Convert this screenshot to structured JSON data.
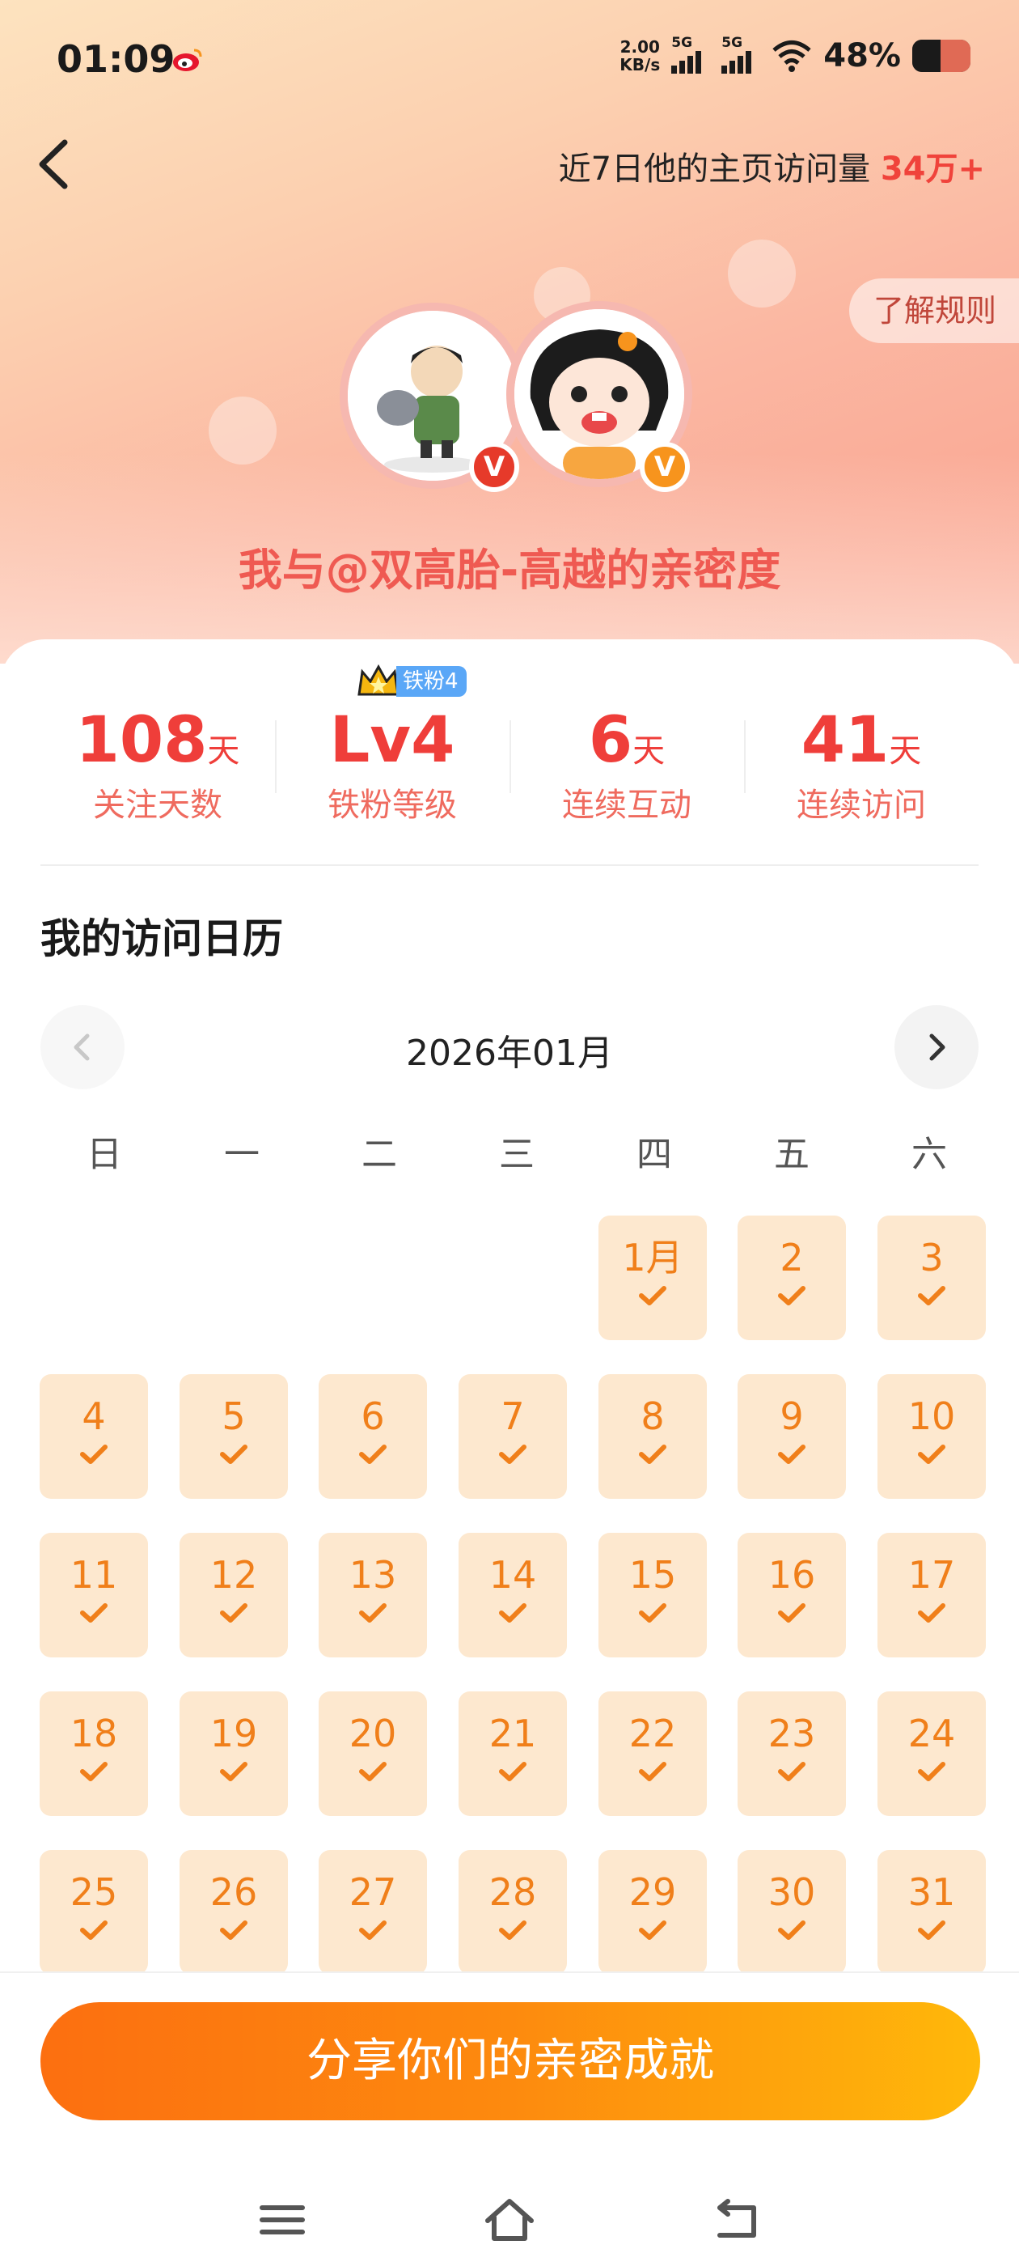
{
  "status_bar": {
    "time": "01:09",
    "net_speed_top": "2.00",
    "net_speed_bottom": "KB/s",
    "sim1": "5G",
    "sim2": "5G",
    "battery": "48%"
  },
  "header": {
    "visits_prefix": "近7日他的主页访问量",
    "visits_value": "34万+",
    "rules_label": "了解规则"
  },
  "intimacy_title": "我与@双高胎-高越的亲密度",
  "badges": {
    "v": "V"
  },
  "fan_badge": "铁粉4",
  "stats": [
    {
      "value": "108",
      "unit": "天",
      "label": "关注天数"
    },
    {
      "value": "Lv4",
      "unit": "",
      "label": "铁粉等级"
    },
    {
      "value": "6",
      "unit": "天",
      "label": "连续互动"
    },
    {
      "value": "41",
      "unit": "天",
      "label": "连续访问"
    }
  ],
  "calendar": {
    "title": "我的访问日历",
    "month": "2026年01月",
    "weekdays": [
      "日",
      "一",
      "二",
      "三",
      "四",
      "五",
      "六"
    ],
    "first_weekday_index": 4,
    "days": [
      "1月",
      "2",
      "3",
      "4",
      "5",
      "6",
      "7",
      "8",
      "9",
      "10",
      "11",
      "12",
      "13",
      "14",
      "15",
      "16",
      "17",
      "18",
      "19",
      "20",
      "21",
      "22",
      "23",
      "24",
      "25",
      "26",
      "27",
      "28",
      "29",
      "30",
      "31"
    ],
    "visited_all": true
  },
  "share_button": "分享你们的亲密成就",
  "colors": {
    "accent": "#ef3e3a",
    "day_bg": "#fde8cf",
    "day_text": "#f07f1a",
    "button_start": "#fc6f10",
    "button_end": "#ffb80a"
  }
}
